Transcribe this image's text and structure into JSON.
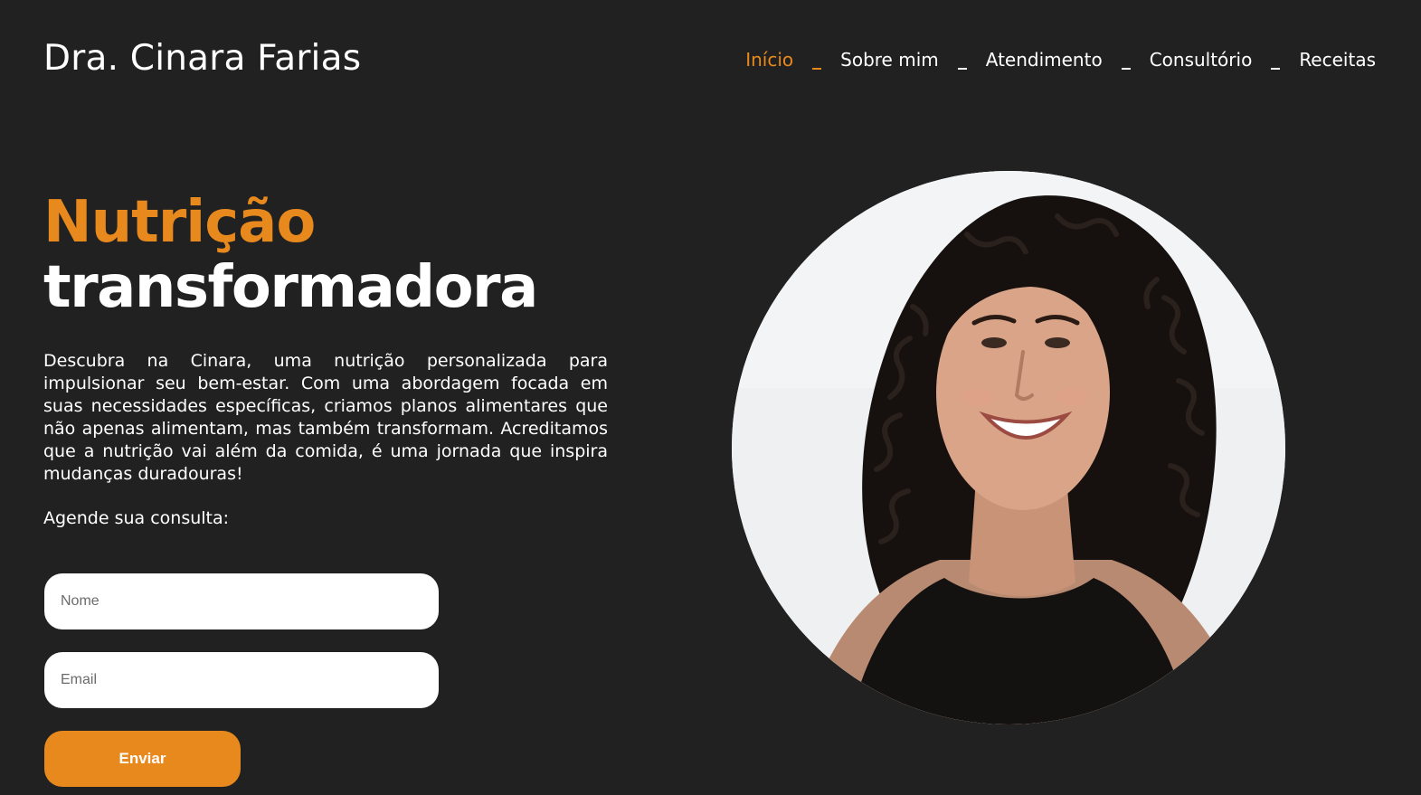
{
  "header": {
    "brand": "Dra. Cinara Farias"
  },
  "nav": {
    "items": [
      {
        "label": "Início",
        "active": true
      },
      {
        "label": "Sobre mim",
        "active": false
      },
      {
        "label": "Atendimento",
        "active": false
      },
      {
        "label": "Consultório",
        "active": false
      },
      {
        "label": "Receitas",
        "active": false
      }
    ]
  },
  "hero": {
    "title_line1": "Nutrição",
    "title_line2": "transformadora",
    "description": "Descubra na Cinara, uma nutrição personalizada para impulsionar seu bem-estar. Com uma abordagem focada em suas necessidades específicas, criamos planos alimentares que não apenas alimentam, mas também transformam. Acreditamos que a nutrição vai além da comida, é uma jornada que inspira mudanças duradouras!",
    "cta_label": "Agende sua consulta:"
  },
  "form": {
    "name_placeholder": "Nome",
    "name_value": "",
    "email_placeholder": "Email",
    "email_value": "",
    "submit_label": "Enviar"
  },
  "portrait": {
    "icon": "portrait-photo"
  },
  "colors": {
    "background": "#212121",
    "accent": "#e8891e",
    "text": "#ffffff",
    "field_background": "#ffffff"
  }
}
